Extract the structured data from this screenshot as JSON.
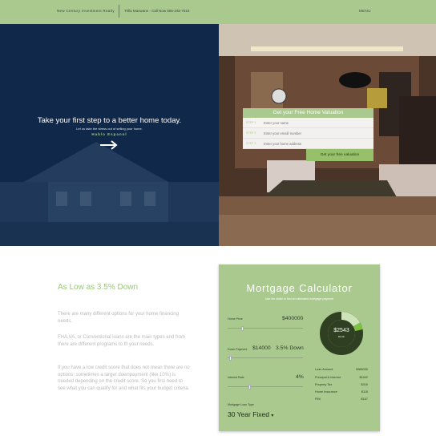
{
  "topbar": {
    "brand": "New Century Investment Realty",
    "contact": "Trilla Maxwane - Call Now 555-245-7515",
    "menu": "MENU"
  },
  "hero": {
    "headline": "Take your first step to a better home today.",
    "sub": "Let us take the stress out of selling your home.",
    "lang": "Hablo Espanol"
  },
  "form": {
    "title": "Get your Free Home Valuation",
    "steps": [
      {
        "step": "STEP 1",
        "placeholder": "Enter your name"
      },
      {
        "step": "STEP 2",
        "placeholder": "Enter your email/ number"
      },
      {
        "step": "STEP 3",
        "placeholder": "Enter your home address"
      }
    ],
    "button": "Get your free valuation"
  },
  "promo": {
    "title": "As Low as 3.5% Down",
    "p1": "There are many different options for your home financing needs.",
    "p2": "FHA,VA, or Conventional loans are the main types and from there are different programs to fit your needs.",
    "p3": "If you have a low credit score that does not mean there are no options; sometimes a larger downpayment (like 10%) is needed depending on the credit score. So you first need to see what you can qualify for and what fits your budget criteria."
  },
  "calculator": {
    "title": "Mortgage Calculator",
    "subtitle": "Use the slider to find an estimated mortgage payment",
    "home_price_label": "Home Price",
    "home_price": "$400000",
    "down_payment_label": "Down Payment",
    "down_payment": "$14000",
    "down_pct": "3.5% Down",
    "interest_label": "Interest Rate",
    "interest": "4%",
    "monthly": "$2543",
    "monthly_sub": "Month",
    "breakdown": [
      {
        "label": "Loan Amount",
        "amount": "$386000"
      },
      {
        "label": "Principal & Interest",
        "amount": "$1842"
      },
      {
        "label": "Property Tax",
        "amount": "$416"
      },
      {
        "label": "Home Insurance",
        "amount": "$118"
      },
      {
        "label": "PMI",
        "amount": "$167"
      }
    ],
    "loan_type_label": "Mortgage Loan Type",
    "loan_type": "30 Year Fixed"
  },
  "sliders": {
    "home_price_fraction": 0.18,
    "down_payment_fraction": 0.02,
    "interest_fraction": 0.28
  },
  "colors": {
    "accent": "#a9c98f",
    "navy": "#10284a",
    "donut_dark": "#2e3f22",
    "donut_light": "#cfe3b8",
    "donut_bright": "#7cc141"
  }
}
